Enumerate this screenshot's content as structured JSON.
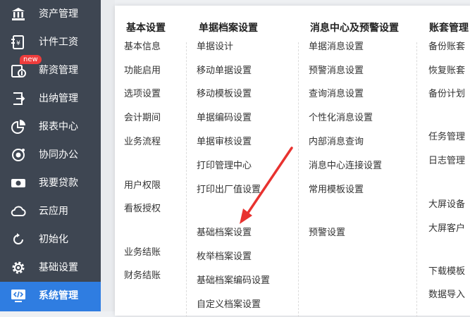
{
  "sidebar": {
    "items": [
      {
        "label": "资产管理",
        "icon": "bank-icon"
      },
      {
        "label": "计件工资",
        "icon": "piece-wage-icon"
      },
      {
        "label": "薪资管理",
        "icon": "salary-icon",
        "badge": "new"
      },
      {
        "label": "出纳管理",
        "icon": "cashier-icon"
      },
      {
        "label": "报表中心",
        "icon": "pie-chart-icon"
      },
      {
        "label": "协同办公",
        "icon": "collaboration-icon"
      },
      {
        "label": "我要贷款",
        "icon": "loan-icon"
      },
      {
        "label": "云应用",
        "icon": "cloud-icon"
      },
      {
        "label": "初始化",
        "icon": "refresh-icon"
      },
      {
        "label": "基础设置",
        "icon": "gear-icon"
      },
      {
        "label": "系统管理",
        "icon": "code-monitor-icon",
        "active": true
      }
    ]
  },
  "columns": [
    {
      "heading": "基本设置",
      "items": [
        "基本信息",
        "功能启用",
        "选项设置",
        "会计期间",
        "业务流程",
        "用户权限",
        "看板授权",
        "业务结账",
        "财务结账"
      ]
    },
    {
      "heading": "单据档案设置",
      "items": [
        "单据设计",
        "移动单据设置",
        "移动模板设置",
        "单据编码设置",
        "单据审核设置",
        "打印管理中心",
        "打印出厂值设置",
        "基础档案设置",
        "枚举档案设置",
        "基础档案编码设置",
        "自定义档案设置"
      ]
    },
    {
      "heading": "消息中心及预警设置",
      "items": [
        "单据消息设置",
        "预警消息设置",
        "查询消息设置",
        "个性化消息设置",
        "内部消息查询",
        "消息中心连接设置",
        "常用模板设置",
        "预警设置"
      ]
    },
    {
      "heading": "账套管理",
      "items": [
        "备份账套",
        "恢复账套",
        "备份计划",
        "任务管理",
        "日志管理",
        "大屏设备",
        "大屏客户",
        "下载模板",
        "数据导入"
      ]
    }
  ],
  "colors": {
    "sidebar_bg": "#3e4652",
    "active_bg": "#2f7de1",
    "badge_bg": "#ee3c3c",
    "arrow": "#e8322f"
  }
}
